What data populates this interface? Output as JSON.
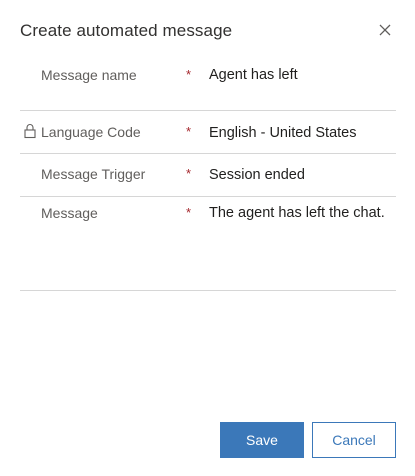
{
  "dialog": {
    "title": "Create automated message",
    "close_icon": "close-icon"
  },
  "fields": {
    "message_name": {
      "label": "Message name",
      "required_marker": "*",
      "value": "Agent has left"
    },
    "language_code": {
      "label": "Language Code",
      "lock_icon": "lock-icon",
      "required_marker": "*",
      "value": "English - United States"
    },
    "message_trigger": {
      "label": "Message Trigger",
      "required_marker": "*",
      "value": "Session ended"
    },
    "message": {
      "label": "Message",
      "required_marker": "*",
      "value": "The agent has left the chat."
    }
  },
  "footer": {
    "save_label": "Save",
    "cancel_label": "Cancel"
  },
  "colors": {
    "primary": "#3b78b9",
    "required": "#a4262c",
    "divider": "#d6d6d6"
  }
}
